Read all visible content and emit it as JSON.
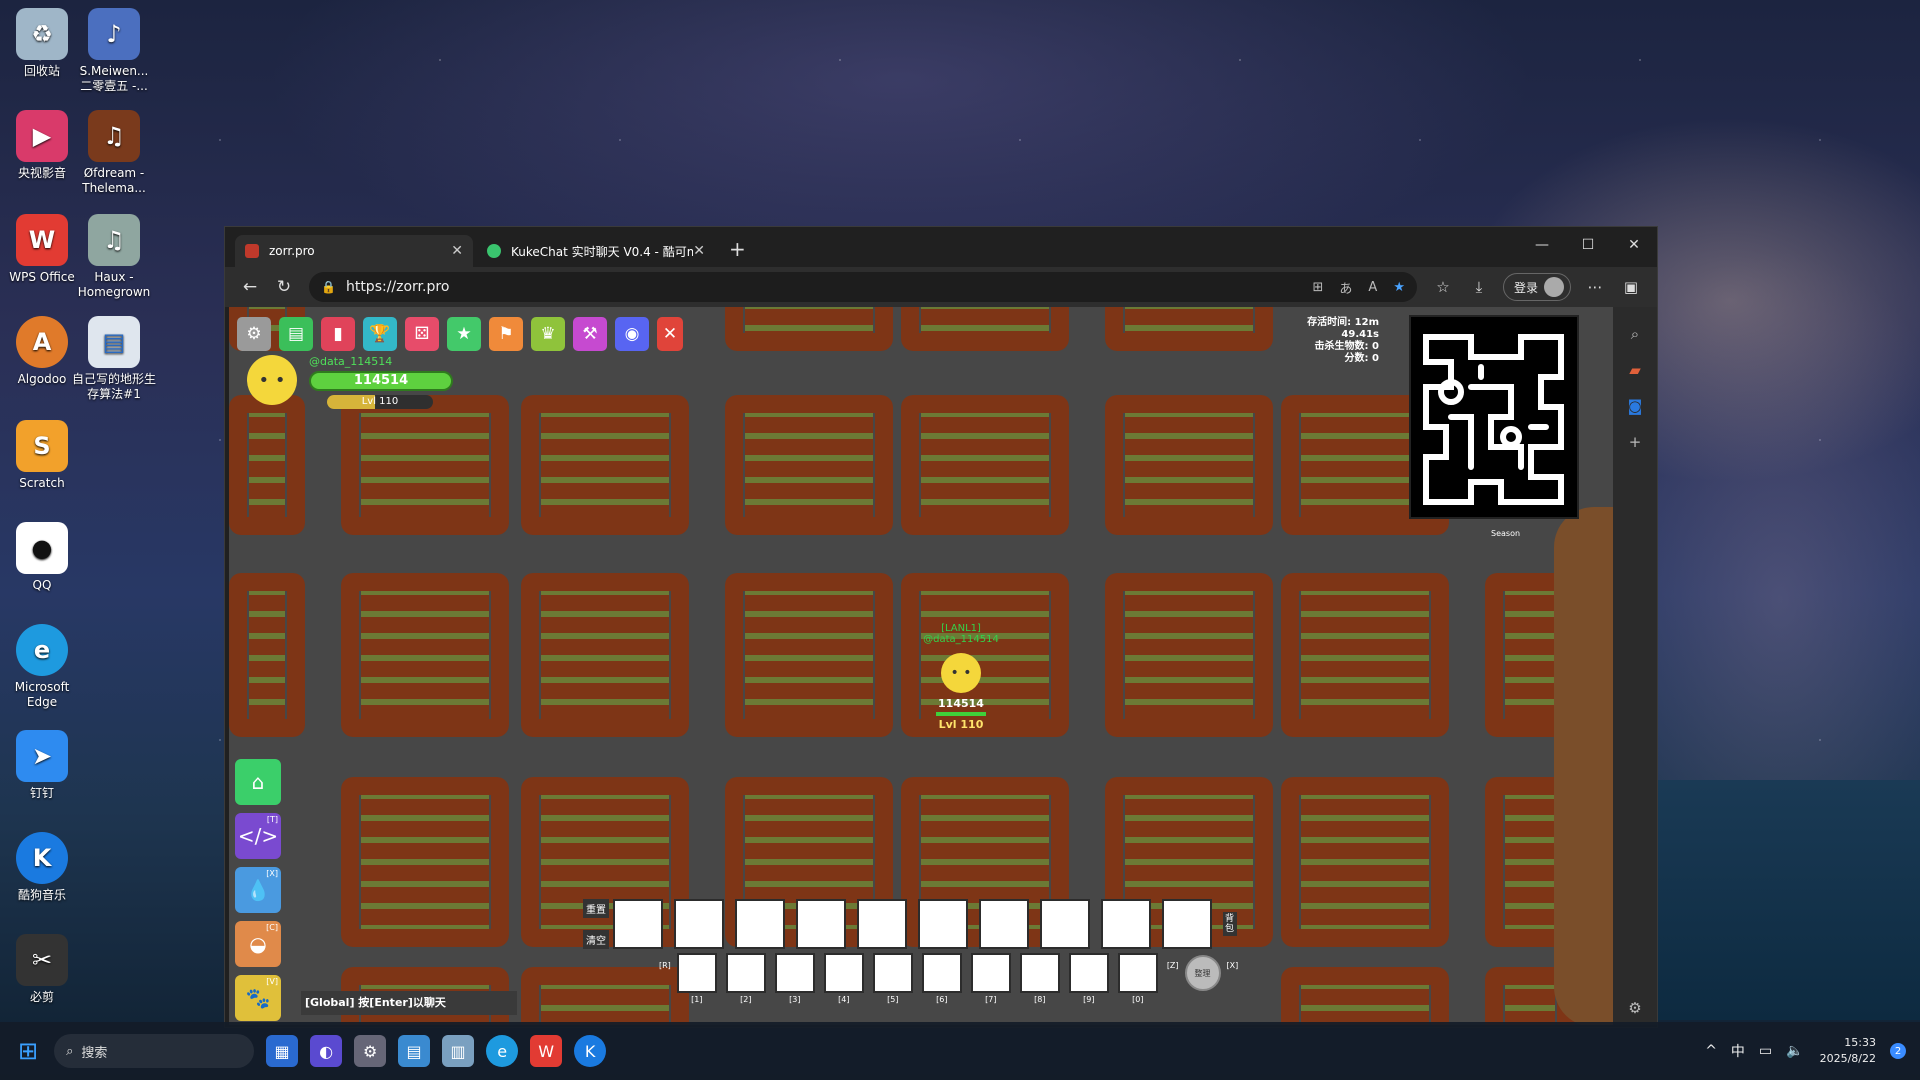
{
  "desktop": {
    "icons": [
      {
        "label": "回收站"
      },
      {
        "label": "S.Meiwen... 二零壹五 -..."
      },
      {
        "label": "央视影音"
      },
      {
        "label": "Øfdream - Thelema..."
      },
      {
        "label": "WPS Office"
      },
      {
        "label": "Haux - Homegrown"
      },
      {
        "label": "Algodoo"
      },
      {
        "label": "自己写的地形生存算法#1"
      },
      {
        "label": "Scratch"
      },
      {
        "label": "QQ"
      },
      {
        "label": "Microsoft Edge"
      },
      {
        "label": "钉钉"
      },
      {
        "label": "酷狗音乐"
      },
      {
        "label": "必剪"
      }
    ]
  },
  "browser": {
    "tabs": [
      {
        "title": "zorr.pro"
      },
      {
        "title": "KukeChat 实时聊天 V0.4 - 酷可m"
      }
    ],
    "url": "https://zorr.pro",
    "login_label": "登录"
  },
  "game": {
    "hud": {
      "name": "@data_114514",
      "score": "114514",
      "level": "Lvl 110",
      "level_fraction": 0.45
    },
    "stats": [
      "存活时间: 12m 49.41s",
      "击杀生物数: 0",
      "分数: 0"
    ],
    "minimap_label": "Season",
    "player": {
      "team": "[LANL1]",
      "name": "@data_114514",
      "score": "114514",
      "level": "Lvl 110"
    },
    "left_buttons": [
      {
        "badge": ""
      },
      {
        "badge": "[T]"
      },
      {
        "badge": "[X]"
      },
      {
        "badge": "[C]"
      },
      {
        "badge": "[V]"
      }
    ],
    "chat_hint": "[Global] 按[Enter]以聊天",
    "inventory": {
      "reset_label": "重置",
      "clear_label": "清空",
      "side_label": "背包",
      "bottom_keys": [
        "[1]",
        "[2]",
        "[3]",
        "[4]",
        "[5]",
        "[6]",
        "[7]",
        "[8]",
        "[9]",
        "[0]"
      ],
      "left_bracket": "[R]",
      "right_bracket": "[Z]",
      "right_bracket2": "[X]",
      "round_label": "整理"
    }
  },
  "taskbar": {
    "search_label": "搜索",
    "ime": "中",
    "time": "15:33",
    "date": "2025/8/22",
    "notif": "2"
  }
}
